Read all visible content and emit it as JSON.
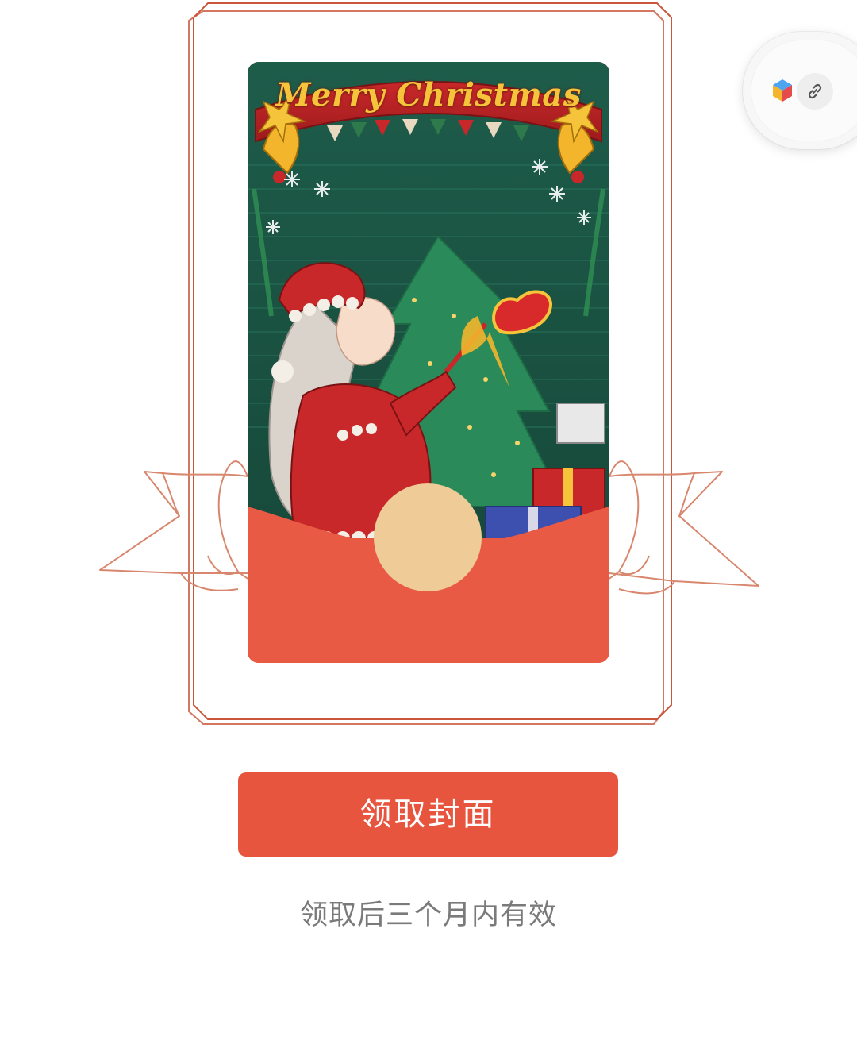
{
  "cover": {
    "title": "Merry Christmas",
    "envelope_color": "#e85a43",
    "coin_color": "#eecb97"
  },
  "floating_toolbar": {
    "icons": [
      "cube-icon",
      "link-icon"
    ]
  },
  "actions": {
    "claim_label": "领取封面"
  },
  "note": {
    "validity_text": "领取后三个月内有效"
  },
  "colors": {
    "accent": "#e8553e",
    "frame_line": "#c9553a",
    "note_text": "#7a7a7a"
  }
}
